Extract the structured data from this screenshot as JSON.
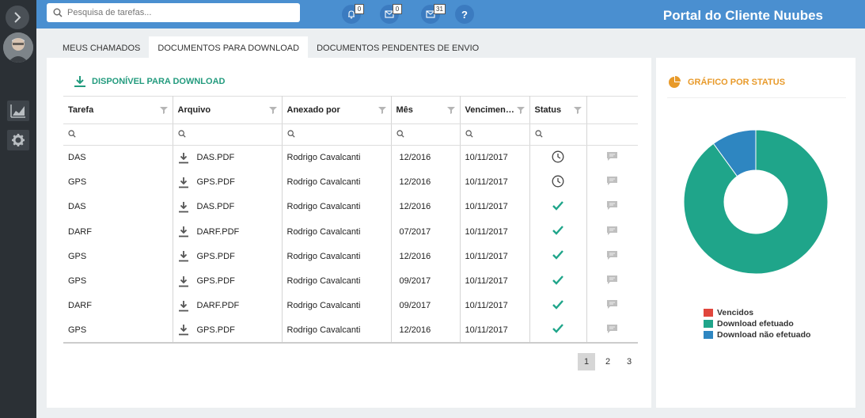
{
  "header": {
    "search_placeholder": "Pesquisa de tarefas...",
    "notifications": [
      {
        "icon": "bell-icon",
        "count": "0"
      },
      {
        "icon": "envelope-icon",
        "count": "0"
      },
      {
        "icon": "envelope-icon",
        "count": "31"
      }
    ],
    "help_label": "?",
    "title": "Portal do Cliente Nuubes"
  },
  "tabs": [
    {
      "label": "MEUS CHAMADOS",
      "active": false
    },
    {
      "label": "DOCUMENTOS PARA DOWNLOAD",
      "active": true
    },
    {
      "label": "DOCUMENTOS PENDENTES DE ENVIO",
      "active": false
    }
  ],
  "main": {
    "section_title": "DISPONÍVEL PARA DOWNLOAD",
    "columns": [
      "Tarefa",
      "Arquivo",
      "Anexado por",
      "Mês",
      "Vencimen…",
      "Status",
      ""
    ],
    "rows": [
      {
        "tarefa": "DAS",
        "arquivo": "DAS.PDF",
        "anexado": "Rodrigo Cavalcanti",
        "mes": "12/2016",
        "venc": "10/11/2017",
        "status": "pending"
      },
      {
        "tarefa": "GPS",
        "arquivo": "GPS.PDF",
        "anexado": "Rodrigo Cavalcanti",
        "mes": "12/2016",
        "venc": "10/11/2017",
        "status": "pending"
      },
      {
        "tarefa": "DAS",
        "arquivo": "DAS.PDF",
        "anexado": "Rodrigo Cavalcanti",
        "mes": "12/2016",
        "venc": "10/11/2017",
        "status": "done"
      },
      {
        "tarefa": "DARF",
        "arquivo": "DARF.PDF",
        "anexado": "Rodrigo Cavalcanti",
        "mes": "07/2017",
        "venc": "10/11/2017",
        "status": "done"
      },
      {
        "tarefa": "GPS",
        "arquivo": "GPS.PDF",
        "anexado": "Rodrigo Cavalcanti",
        "mes": "12/2016",
        "venc": "10/11/2017",
        "status": "done"
      },
      {
        "tarefa": "GPS",
        "arquivo": "GPS.PDF",
        "anexado": "Rodrigo Cavalcanti",
        "mes": "09/2017",
        "venc": "10/11/2017",
        "status": "done"
      },
      {
        "tarefa": "DARF",
        "arquivo": "DARF.PDF",
        "anexado": "Rodrigo Cavalcanti",
        "mes": "09/2017",
        "venc": "10/11/2017",
        "status": "done"
      },
      {
        "tarefa": "GPS",
        "arquivo": "GPS.PDF",
        "anexado": "Rodrigo Cavalcanti",
        "mes": "12/2016",
        "venc": "10/11/2017",
        "status": "done"
      }
    ],
    "pages": [
      "1",
      "2",
      "3"
    ],
    "current_page": "1"
  },
  "side": {
    "title": "GRÁFICO POR STATUS"
  },
  "chart_data": {
    "type": "pie",
    "title": "GRÁFICO POR STATUS",
    "categories": [
      "Vencidos",
      "Download efetuado",
      "Download não efetuado"
    ],
    "values": [
      0,
      90,
      10
    ],
    "colors": [
      "#e0463c",
      "#1fa58a",
      "#2e86c1"
    ],
    "donut": true,
    "legend_position": "bottom"
  },
  "colors": {
    "accent": "#4a8fd0",
    "teal": "#239b7e",
    "orange": "#e89a2a"
  }
}
